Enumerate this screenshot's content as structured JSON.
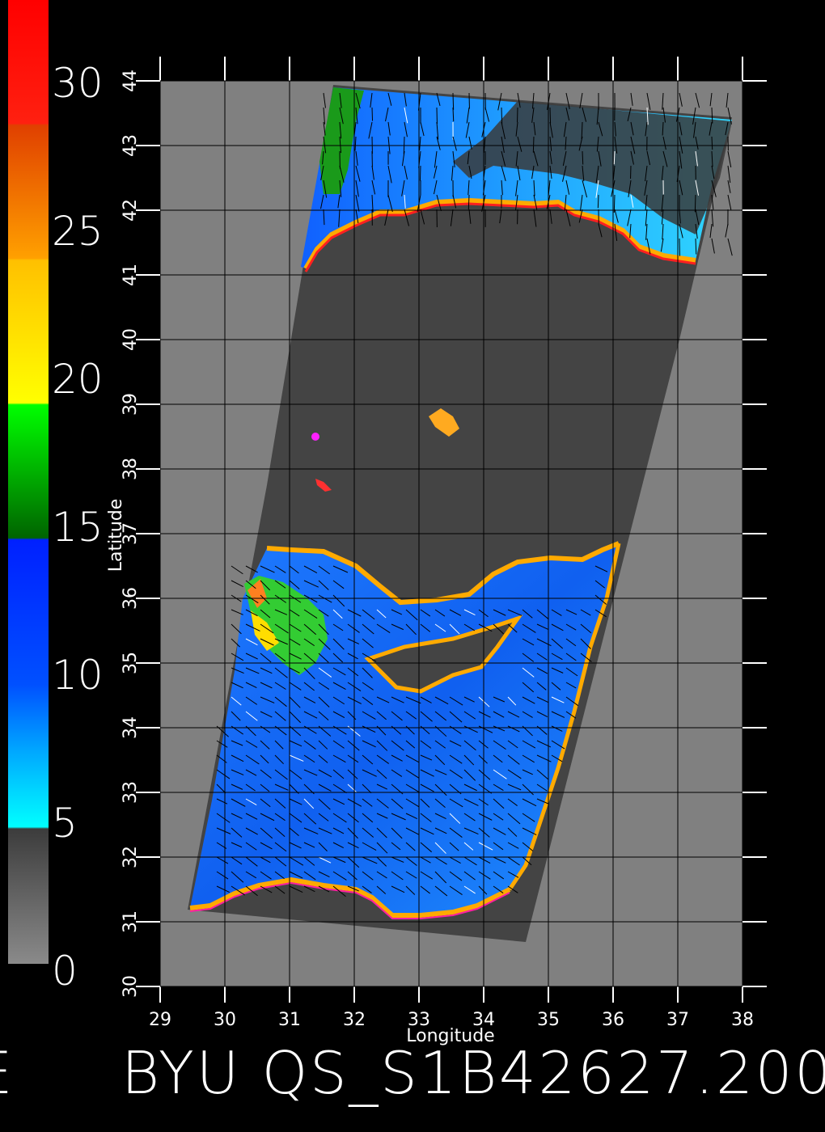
{
  "map": {
    "footer_text": "BYU QS_S1B42627.200",
    "footer_left_fragment": "E",
    "xlabel": "Longitude",
    "ylabel": "Latitude",
    "lon_ticks": [
      "29",
      "30",
      "31",
      "32",
      "33",
      "34",
      "35",
      "36",
      "37",
      "38"
    ],
    "lat_ticks": [
      "30",
      "31",
      "32",
      "33",
      "34",
      "35",
      "36",
      "37",
      "38",
      "39",
      "40",
      "41",
      "42",
      "43",
      "44"
    ]
  },
  "colorbar": {
    "labels": [
      "0",
      "5",
      "10",
      "15",
      "20",
      "25",
      "30"
    ],
    "colors": [
      "#808080",
      "#404040",
      "#00ffff",
      "#0080ff",
      "#0000ff",
      "#008000",
      "#00ff00",
      "#ffff00",
      "#ffc000",
      "#ff8000",
      "#ff4000",
      "#ff0000"
    ]
  },
  "colors": {
    "background": "#000000",
    "land": "#808080",
    "no_data": "#444444",
    "grid": "#000000"
  }
}
